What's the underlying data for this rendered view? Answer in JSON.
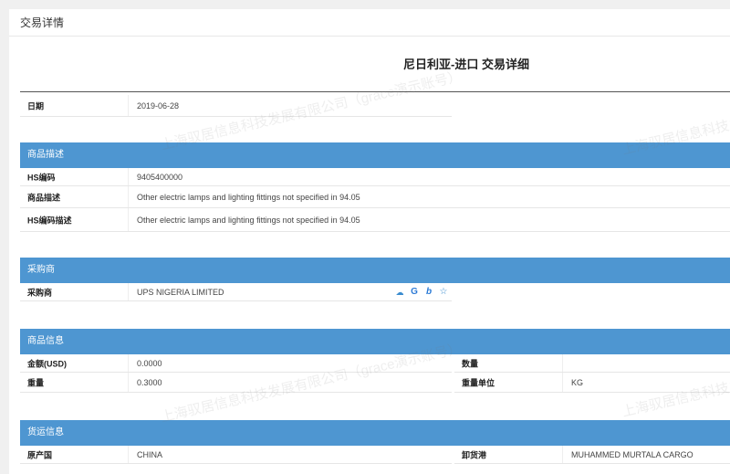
{
  "panel": {
    "title": "交易详情"
  },
  "report": {
    "title": "尼日利亚-进口 交易详细"
  },
  "date": {
    "label": "日期",
    "value": "2019-06-28"
  },
  "product_desc": {
    "section_title": "商品描述",
    "rows": [
      {
        "label": "HS编码",
        "value": "9405400000"
      },
      {
        "label": "商品描述",
        "value": "Other electric lamps and lighting fittings not specified in 94.05"
      },
      {
        "label": "HS编码描述",
        "value": "Other electric lamps and lighting fittings not specified in 94.05"
      }
    ]
  },
  "buyer": {
    "section_title": "采购商",
    "label": "采购商",
    "value": "UPS NIGERIA LIMITED",
    "icons": [
      "cloud-search-icon",
      "google-icon",
      "bing-icon",
      "star-icon"
    ]
  },
  "product_info": {
    "section_title": "商品信息",
    "amount": {
      "label": "金额(USD)",
      "value": "0.0000"
    },
    "quantity": {
      "label": "数量",
      "value": ""
    },
    "weight": {
      "label": "重量",
      "value": "0.3000"
    },
    "weight_unit": {
      "label": "重量单位",
      "value": "KG"
    }
  },
  "shipping": {
    "section_title": "货运信息",
    "origin": {
      "label": "原产国",
      "value": "CHINA"
    },
    "port": {
      "label": "卸货港",
      "value": "MUHAMMED MURTALA CARGO"
    }
  },
  "watermark": {
    "text": "上海驭居信息科技发展有限公司（grace演示账号）",
    "text_short": "上海驭居信息科技发"
  },
  "colors": {
    "section_bar": "#4e96d1",
    "background": "#f0f0f0"
  }
}
